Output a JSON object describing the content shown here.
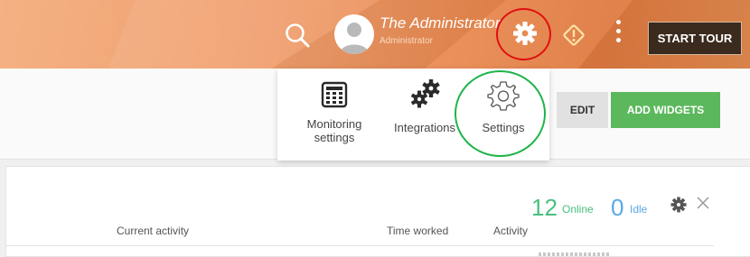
{
  "topbar": {
    "user_name": "The Administrator",
    "user_role": "Administrator",
    "start_tour_label": "START TOUR",
    "icons": [
      "search-icon",
      "avatar-icon",
      "gear-icon",
      "warning-icon",
      "more-vertical-icon"
    ],
    "highlight_colors": {
      "settings_gear_ring": "#e01010",
      "settings_item_ring": "#1fb44b"
    }
  },
  "settings_menu": {
    "items": [
      {
        "label": "Monitoring\nsettings",
        "icon": "monitoring-settings-icon"
      },
      {
        "label": "Integrations",
        "icon": "integrations-gears-icon"
      },
      {
        "label": "Settings",
        "icon": "settings-gear-outline-icon"
      }
    ]
  },
  "actions": {
    "edit_label": "EDIT",
    "add_widgets_label": "ADD WIDGETS"
  },
  "panel": {
    "online_count": "12",
    "online_label": "Online",
    "idle_count": "0",
    "idle_label": "Idle",
    "columns": [
      "Current activity",
      "Time worked",
      "Activity"
    ],
    "colors": {
      "online": "#48c07e",
      "idle": "#5aa9e6"
    }
  }
}
